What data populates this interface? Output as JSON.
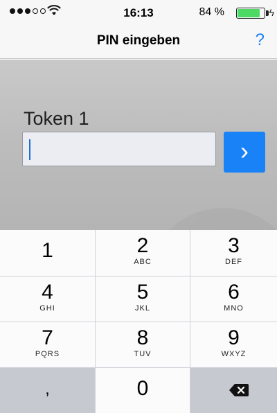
{
  "status_bar": {
    "time": "16:13",
    "battery_percent": "84 %",
    "battery_level": 0.84,
    "signal_bars": 3,
    "signal_total": 5,
    "colors": {
      "battery_fill": "#4cd964"
    }
  },
  "nav": {
    "title": "PIN eingeben",
    "help_label": "?"
  },
  "form": {
    "token_label": "Token 1",
    "pin_value": "",
    "go_label": "›"
  },
  "keypad": {
    "keys": [
      {
        "num": "1",
        "letters": ""
      },
      {
        "num": "2",
        "letters": "ABC"
      },
      {
        "num": "3",
        "letters": "DEF"
      },
      {
        "num": "4",
        "letters": "GHI"
      },
      {
        "num": "5",
        "letters": "JKL"
      },
      {
        "num": "6",
        "letters": "MNO"
      },
      {
        "num": "7",
        "letters": "PQRS"
      },
      {
        "num": "8",
        "letters": "TUV"
      },
      {
        "num": "9",
        "letters": "WXYZ"
      }
    ],
    "comma": ",",
    "zero": "0",
    "backspace_icon": "backspace-icon"
  },
  "colors": {
    "accent": "#1a82f7",
    "keypad_bg": "#cfd2d8"
  }
}
